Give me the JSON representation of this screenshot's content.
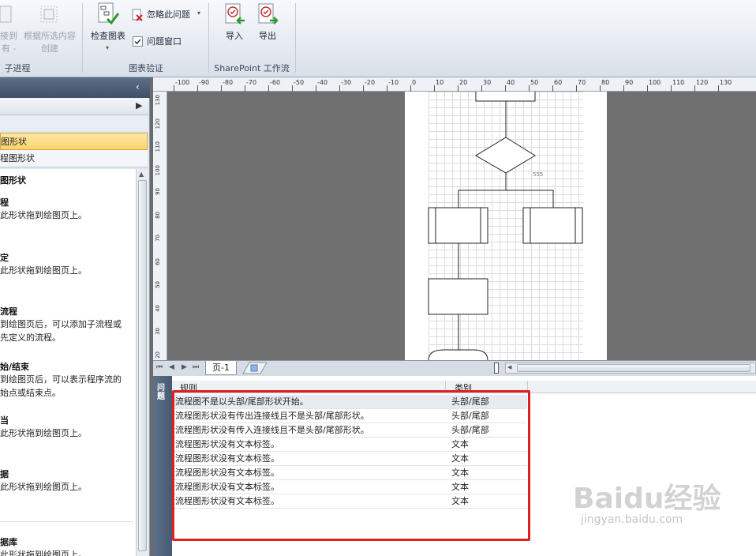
{
  "ribbon": {
    "btn_connect_line1": "接到",
    "btn_connect_line2": "有 -",
    "btn_create_line1": "根据所选内容",
    "btn_create_line2": "创建",
    "group_subprocess": "子进程",
    "btn_check_diagram": "检查图表",
    "btn_ignore_issue": "忽略此问题",
    "chk_issues_window": "问题窗口",
    "group_validation": "图表验证",
    "btn_import": "导入",
    "btn_export": "导出",
    "group_sharepoint": "SharePoint 工作流"
  },
  "left_panel": {
    "tab_active": "图形状",
    "tab_second": "程图形状",
    "list_heading": "图形状",
    "items": [
      {
        "title": "程",
        "desc": [
          "此形状拖到绘图页上。"
        ]
      },
      {
        "title": "定",
        "desc": [
          "此形状拖到绘图页上。"
        ]
      },
      {
        "title": "流程",
        "desc": [
          "到绘图页后，可以添加子流程或",
          "先定义的流程。"
        ]
      },
      {
        "title": "始/结束",
        "desc": [
          "到绘图页后，可以表示程序流的",
          "始点或结束点。"
        ]
      },
      {
        "title": "当",
        "desc": [
          "此形状拖到绘图页上。"
        ]
      },
      {
        "title": "据",
        "desc": [
          "此形状拖到绘图页上。"
        ]
      },
      {
        "title": "据库",
        "desc": [
          "此形状拖到绘图页上。"
        ]
      }
    ]
  },
  "ruler_top_labels": [
    "-100",
    "-90",
    "-80",
    "-70",
    "-60",
    "-50",
    "-40",
    "-30",
    "-20",
    "-10",
    "0",
    "10",
    "20",
    "30",
    "40",
    "50",
    "60",
    "70",
    "80",
    "90",
    "100",
    "110",
    "120",
    "130"
  ],
  "ruler_left_labels": [
    "130",
    "120",
    "110",
    "100",
    "90",
    "80",
    "70",
    "60",
    "50",
    "40",
    "30",
    "20"
  ],
  "canvas": {
    "shape_label": "555"
  },
  "tabbar": {
    "page_tab": "页-1"
  },
  "issues": {
    "side_title": "问题",
    "col_rule": "规则",
    "col_category": "类别",
    "rows": [
      {
        "rule": "流程图不是以头部/尾部形状开始。",
        "category": "头部/尾部"
      },
      {
        "rule": "流程图形状没有传出连接线且不是头部/尾部形状。",
        "category": "头部/尾部"
      },
      {
        "rule": "流程图形状没有传入连接线且不是头部/尾部形状。",
        "category": "头部/尾部"
      },
      {
        "rule": "流程图形状没有文本标签。",
        "category": "文本"
      },
      {
        "rule": "流程图形状没有文本标签。",
        "category": "文本"
      },
      {
        "rule": "流程图形状没有文本标签。",
        "category": "文本"
      },
      {
        "rule": "流程图形状没有文本标签。",
        "category": "文本"
      },
      {
        "rule": "流程图形状没有文本标签。",
        "category": "文本"
      }
    ]
  },
  "watermark": {
    "brand": "Baidu经验",
    "url": "jingyan.baidu.com"
  },
  "colors": {
    "highlight_border": "#e0201e",
    "active_tab": "#fbd46a"
  }
}
